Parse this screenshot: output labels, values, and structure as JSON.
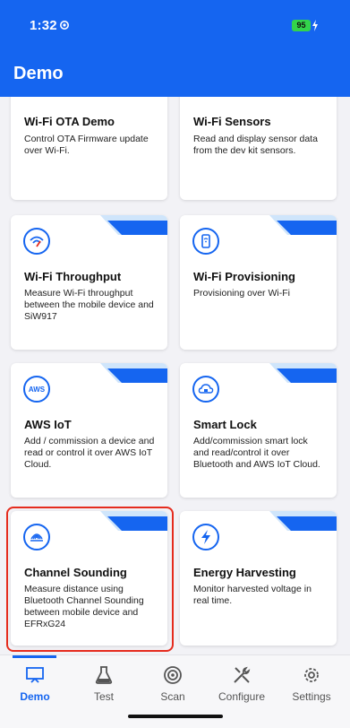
{
  "status": {
    "time": "1:32",
    "battery": "95"
  },
  "header": {
    "title": "Demo"
  },
  "cards": [
    {
      "title": "Wi-Fi OTA Demo",
      "desc": "Control OTA Firmware update over Wi-Fi."
    },
    {
      "title": "Wi-Fi Sensors",
      "desc": "Read and display sensor data from the dev kit sensors."
    },
    {
      "title": "Wi-Fi Throughput",
      "desc": "Measure Wi-Fi throughput between the mobile device and SiW917"
    },
    {
      "title": "Wi-Fi Provisioning",
      "desc": "Provisioning over Wi-Fi"
    },
    {
      "title": "AWS IoT",
      "desc": "Add / commission a device and read or control it over AWS IoT Cloud.",
      "icon_text": "AWS"
    },
    {
      "title": "Smart Lock",
      "desc": "Add/commission smart lock and read/control it over Bluetooth and AWS IoT Cloud."
    },
    {
      "title": "Channel Sounding",
      "desc": "Measure distance using Bluetooth Channel Sounding between mobile device and EFRxG24"
    },
    {
      "title": "Energy Harvesting",
      "desc": "Monitor harvested voltage in real time."
    }
  ],
  "tabs": [
    {
      "label": "Demo",
      "icon": "demo-icon",
      "active": true
    },
    {
      "label": "Test",
      "icon": "flask-icon"
    },
    {
      "label": "Scan",
      "icon": "scan-icon"
    },
    {
      "label": "Configure",
      "icon": "tools-icon"
    },
    {
      "label": "Settings",
      "icon": "gear-icon"
    }
  ],
  "colors": {
    "accent": "#1565f0",
    "highlight": "#e52c1e",
    "battery": "#33d44b"
  }
}
